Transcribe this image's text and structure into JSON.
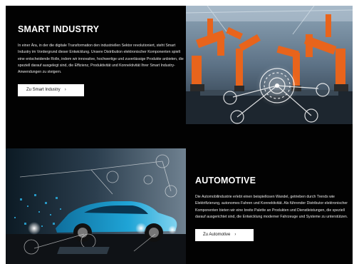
{
  "smart_industry": {
    "title": "SMART INDUSTRY",
    "description": "In einer Ära, in der die digitale Transformation den industriellen Sektor revolutioniert, steht Smart Industry im Vordergrund dieser Entwicklung. Unsere Distribution elektronischer Komponenten spielt eine entscheidende Rolle, indem wir innovative, hochwertige und zuverlässige Produkte anbieten, die speziell darauf ausgelegt sind, die Effizienz, Produktivität und Konnektivität Ihrer Smart Industry-Anwendungen zu steigern.",
    "button_label": "Zu Smart Industry",
    "button_icon": "chevron-right-icon"
  },
  "automotive": {
    "title": "AUTOMOTIVE",
    "description": "Die Automobilindustrie erlebt einen beispiellosen Wandel, getrieben durch Trends wie Elektrifizierung, autonomes Fahren und Konnektivität. Als führender Distributor elektronischer Komponenten bieten wir eine breite Palette an Produkten und Dienstleistungen, die speziell darauf ausgerichtet sind, die Entwicklung moderner Fahrzeuge und Systeme zu unterstützen.",
    "button_label": "Zu Automotive",
    "button_icon": "chevron-right-icon"
  },
  "colors": {
    "background": "#020202",
    "text": "#ffffff",
    "button_bg": "#ffffff",
    "robot_orange": "#e8641c",
    "car_blue": "#1fa4d6"
  }
}
